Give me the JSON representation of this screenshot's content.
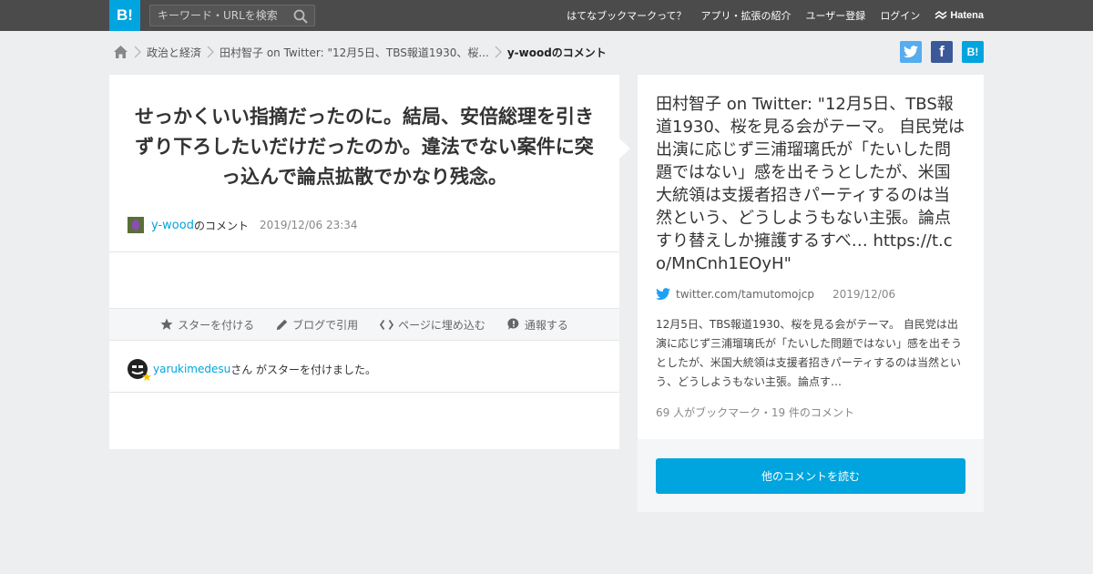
{
  "header": {
    "logo": "B!",
    "search_placeholder": "キーワード・URLを検索",
    "nav": [
      "はてなブックマークって？",
      "アプリ・拡張の紹介",
      "ユーザー登録",
      "ログイン"
    ],
    "brand": "Hatena"
  },
  "breadcrumb": {
    "items": [
      "政治と経済",
      "田村智子 on Twitter: \"12月5日、TBS報道1930、桜...",
      "y-woodのコメント"
    ]
  },
  "share": {
    "twitter": "t",
    "facebook": "f",
    "hatena": "B!"
  },
  "comment": {
    "text": "せっかくいい指摘だったのに。結局、安倍総理を引きずり下ろしたいだけだったのか。違法でない案件に突っ込んで論点拡散でかなり残念。",
    "user": "y-wood",
    "suffix": "のコメント",
    "date": "2019/12/06 23:34"
  },
  "actions": [
    "スターを付ける",
    "ブログで引用",
    "ページに埋め込む",
    "通報する"
  ],
  "star": {
    "user": "yarukimedesu",
    "text": "さん がスターを付けました。"
  },
  "entry": {
    "title": "田村智子 on Twitter: \"12月5日、TBS報道1930、桜を見る会がテーマ。 自民党は出演に応じず三浦瑠璃氏が「たいした問題ではない」感を出そうとしたが、米国大統領は支援者招きパーティするのは当然という、どうしようもない主張。論点すり替えしか擁護するすべ… https://t.co/MnCnh1EOyH\"",
    "domain": "twitter.com/tamutomojcp",
    "date": "2019/12/06",
    "summary": "12月5日、TBS報道1930、桜を見る会がテーマ。 自民党は出演に応じず三浦瑠璃氏が「たいした問題ではない」感を出そうとしたが、米国大統領は支援者招きパーティするのは当然という、どうしようもない主張。論点す…",
    "counts": "69 人がブックマーク・19 件のコメント",
    "more_button": "他のコメントを読む"
  },
  "colors": {
    "brand": "#00a4de",
    "header_bg": "#4b4b4b",
    "page_bg": "#eceef0"
  }
}
